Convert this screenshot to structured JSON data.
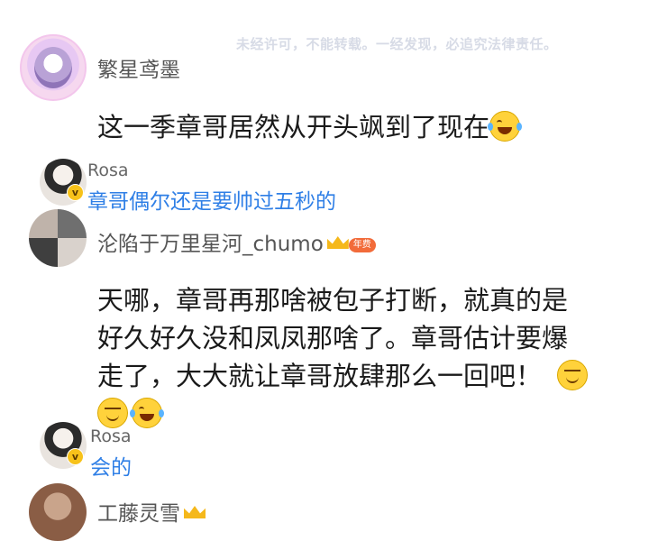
{
  "watermark": "未经许可，不能转载。一经发现，必追究法律责任。",
  "comments": [
    {
      "author": "繁星鸢墨",
      "text": "这一季章哥居然从开头飒到了现在",
      "reply": {
        "author": "Rosa",
        "badge": "v",
        "text": "章哥偶尔还是要帅过五秒的"
      }
    },
    {
      "author": "沦陷于万里星河_chumo",
      "vip_label": "年费",
      "text_lines": [
        "天哪，章哥再那啥被包子打断，就真的是",
        "好久好久没和凤凤那啥了。章哥估计要爆",
        "走了，大大就让章哥放肆那么一回吧！"
      ],
      "reply": {
        "author": "Rosa",
        "badge": "v",
        "text": "会的"
      }
    },
    {
      "author": "工藤灵雪"
    }
  ],
  "icons": {
    "laugh": "laughing-tears-emoji",
    "smile": "smiling-emoji",
    "crown": "vip-crown-icon"
  },
  "colors": {
    "reply_text": "#2f7fe6",
    "badge": "#f7c21a",
    "vip": "#f26b3a"
  }
}
